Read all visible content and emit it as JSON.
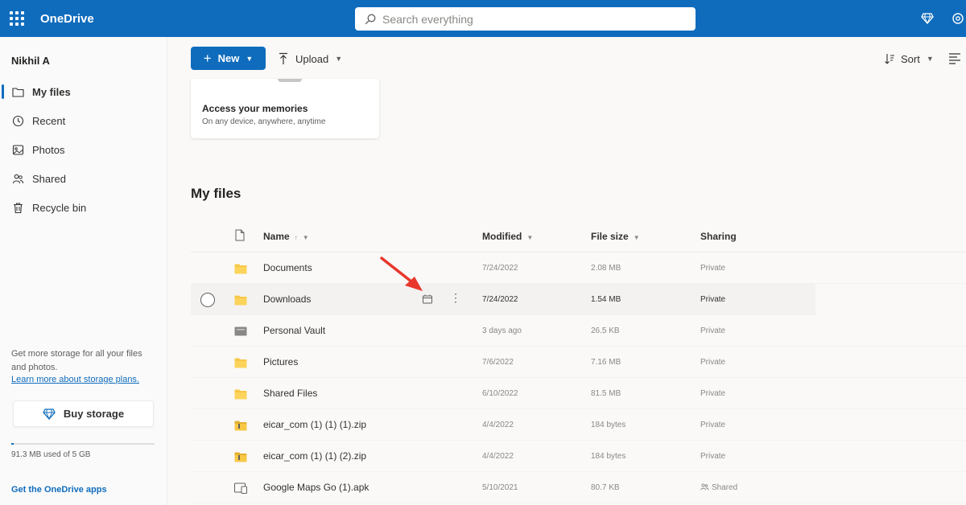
{
  "app": {
    "name": "OneDrive"
  },
  "search": {
    "placeholder": "Search everything"
  },
  "user": {
    "name": "Nikhil A"
  },
  "sidebar": {
    "items": [
      {
        "label": "My files",
        "icon": "folder-icon",
        "active": true
      },
      {
        "label": "Recent",
        "icon": "clock-icon",
        "active": false
      },
      {
        "label": "Photos",
        "icon": "image-icon",
        "active": false
      },
      {
        "label": "Shared",
        "icon": "people-icon",
        "active": false
      },
      {
        "label": "Recycle bin",
        "icon": "trash-icon",
        "active": false
      }
    ],
    "storage_note": "Get more storage for all your files and photos.",
    "storage_link": "Learn more about storage plans.",
    "buy_storage": "Buy storage",
    "usage_text": "91.3 MB used of 5 GB",
    "usage_fraction": 0.018,
    "get_apps": "Get the OneDrive apps"
  },
  "toolbar": {
    "new_label": "New",
    "upload_label": "Upload",
    "sort_label": "Sort"
  },
  "memories": {
    "title": "Access your memories",
    "subtitle": "On any device, anywhere, anytime"
  },
  "section_title": "My files",
  "table": {
    "columns": {
      "name": "Name",
      "modified": "Modified",
      "size": "File size",
      "sharing": "Sharing"
    },
    "rows": [
      {
        "name": "Documents",
        "type": "folder",
        "modified": "7/24/2022",
        "size": "2.08 MB",
        "sharing": "Private"
      },
      {
        "name": "Downloads",
        "type": "folder",
        "modified": "7/24/2022",
        "size": "1.54 MB",
        "sharing": "Private"
      },
      {
        "name": "Personal Vault",
        "type": "vault",
        "modified": "3 days ago",
        "size": "26.5 KB",
        "sharing": "Private"
      },
      {
        "name": "Pictures",
        "type": "folder",
        "modified": "7/6/2022",
        "size": "7.16 MB",
        "sharing": "Private"
      },
      {
        "name": "Shared Files",
        "type": "folder",
        "modified": "6/10/2022",
        "size": "81.5 MB",
        "sharing": "Private"
      },
      {
        "name": "eicar_com (1) (1) (1).zip",
        "type": "zip",
        "modified": "4/4/2022",
        "size": "184 bytes",
        "sharing": "Private"
      },
      {
        "name": "eicar_com (1) (1) (2).zip",
        "type": "zip",
        "modified": "4/4/2022",
        "size": "184 bytes",
        "sharing": "Private"
      },
      {
        "name": "Google Maps Go (1).apk",
        "type": "apk",
        "modified": "5/10/2021",
        "size": "80.7 KB",
        "sharing": "Shared"
      }
    ]
  },
  "colors": {
    "brand": "#0f6cbd",
    "folder": "#f7c846",
    "annotation_arrow": "#e8372c"
  }
}
